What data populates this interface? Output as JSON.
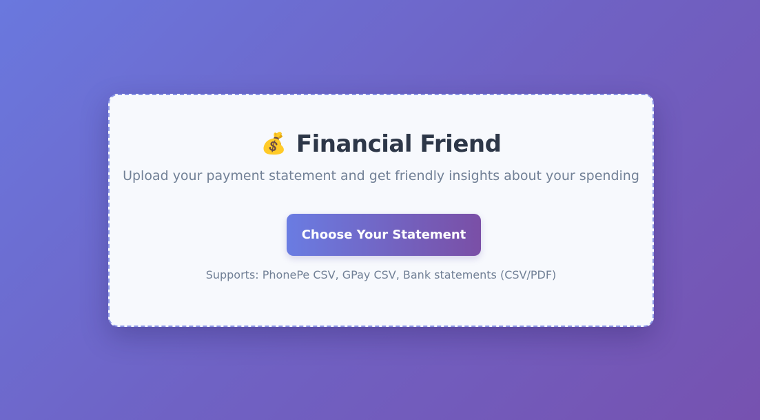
{
  "app": {
    "icon": "money-bag-icon",
    "icon_glyph": "💰",
    "title": "Financial Friend",
    "subtitle": "Upload your payment statement and get friendly insights about your spending"
  },
  "upload": {
    "button_label": "Choose Your Statement",
    "supports_text": "Supports: PhonePe CSV, GPay CSV, Bank statements (CSV/PDF)"
  },
  "colors": {
    "background_start": "#6a78de",
    "background_end": "#7652b0",
    "card_background": "#f7f9fd",
    "card_border": "#8a95e6",
    "title_text": "#2d3748",
    "muted_text": "#718096",
    "button_start": "#6a7ce2",
    "button_end": "#7a4fa6"
  }
}
